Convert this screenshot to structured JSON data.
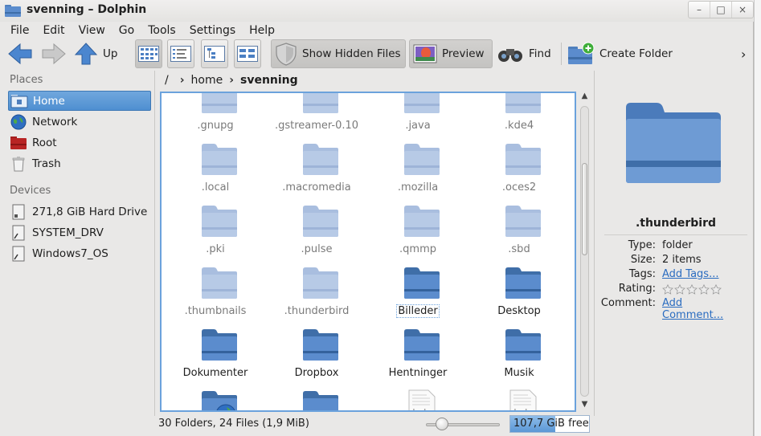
{
  "window": {
    "title": "svenning – Dolphin",
    "buttons": [
      "–",
      "□",
      "×"
    ]
  },
  "menu": [
    "File",
    "Edit",
    "View",
    "Go",
    "Tools",
    "Settings",
    "Help"
  ],
  "toolbar": {
    "up_label": "Up",
    "show_hidden_label": "Show Hidden Files",
    "preview_label": "Preview",
    "find_label": "Find",
    "create_folder_label": "Create Folder",
    "overflow": "›"
  },
  "places": {
    "title": "Places",
    "items": [
      "Home",
      "Network",
      "Root",
      "Trash"
    ],
    "devices_title": "Devices",
    "devices": [
      "271,8 GiB Hard Drive",
      "SYSTEM_DRV",
      "Windows7_OS"
    ]
  },
  "breadcrumb": {
    "root": "/",
    "items": [
      "home",
      "svenning"
    ],
    "separator": "›"
  },
  "files": [
    {
      "name": ".gnupg",
      "kind": "hidden-folder"
    },
    {
      "name": ".gstreamer-0.10",
      "kind": "hidden-folder"
    },
    {
      "name": ".java",
      "kind": "hidden-folder"
    },
    {
      "name": ".kde4",
      "kind": "hidden-folder"
    },
    {
      "name": ".local",
      "kind": "hidden-folder"
    },
    {
      "name": ".macromedia",
      "kind": "hidden-folder"
    },
    {
      "name": ".mozilla",
      "kind": "hidden-folder"
    },
    {
      "name": ".oces2",
      "kind": "hidden-folder"
    },
    {
      "name": ".pki",
      "kind": "hidden-folder"
    },
    {
      "name": ".pulse",
      "kind": "hidden-folder"
    },
    {
      "name": ".qmmp",
      "kind": "hidden-folder"
    },
    {
      "name": ".sbd",
      "kind": "hidden-folder"
    },
    {
      "name": ".thumbnails",
      "kind": "hidden-folder"
    },
    {
      "name": ".thunderbird",
      "kind": "hidden-folder"
    },
    {
      "name": "Billeder",
      "kind": "folder"
    },
    {
      "name": "Desktop",
      "kind": "folder"
    },
    {
      "name": "Dokumenter",
      "kind": "folder"
    },
    {
      "name": "Dropbox",
      "kind": "folder"
    },
    {
      "name": "Hentninger",
      "kind": "folder"
    },
    {
      "name": "Musik",
      "kind": "folder"
    },
    {
      "name": "",
      "kind": "globe-folder"
    },
    {
      "name": "",
      "kind": "folder"
    },
    {
      "name": "",
      "kind": "txt-file",
      "badge": "txt"
    },
    {
      "name": "",
      "kind": "txt-file",
      "badge": "txt"
    }
  ],
  "focused_file": "Billeder",
  "info_panel": {
    "name": ".thunderbird",
    "type_key": "Type:",
    "type_val": "folder",
    "size_key": "Size:",
    "size_val": "2 items",
    "tags_key": "Tags:",
    "tags_val": "Add Tags...",
    "rating_key": "Rating:",
    "rating": 0,
    "rating_max": 5,
    "comment_key": "Comment:",
    "comment_val_1": "Add",
    "comment_val_2": "Comment..."
  },
  "status": {
    "summary": "30 Folders, 24 Files (1,9 MiB)",
    "free_label": "107,7 GiB free",
    "disk_used_fraction": 0.57,
    "zoom_fraction": 0.13
  },
  "colors": {
    "accent": "#4f8fd1",
    "folder": "#5b8ccd",
    "hidden_folder": "#b7cae6"
  }
}
